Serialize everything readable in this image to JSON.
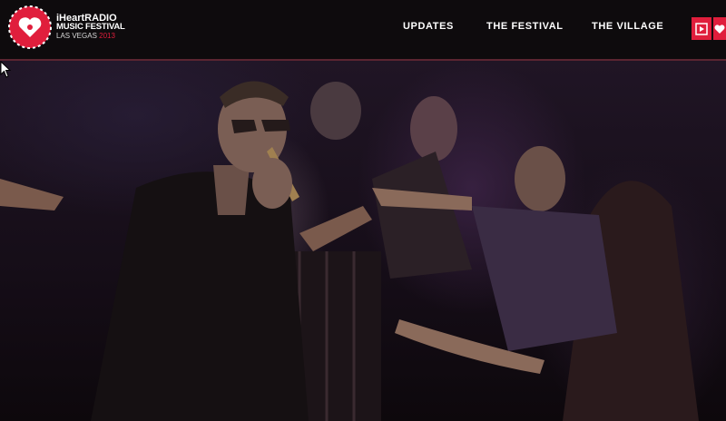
{
  "brand": {
    "line1": "iHeartRADIO",
    "line2": "MUSIC FESTIVAL",
    "line3_city": "LAS VEGAS",
    "line3_year": "2013",
    "accent": "#e01e3c"
  },
  "nav": {
    "items": [
      {
        "label": "UPDATES"
      },
      {
        "label": "THE FESTIVAL"
      },
      {
        "label": "THE VILLAGE"
      }
    ]
  },
  "header_icons": [
    "play-icon",
    "iheart-icon"
  ],
  "hero": {
    "image": "concert-crowd-photo"
  }
}
